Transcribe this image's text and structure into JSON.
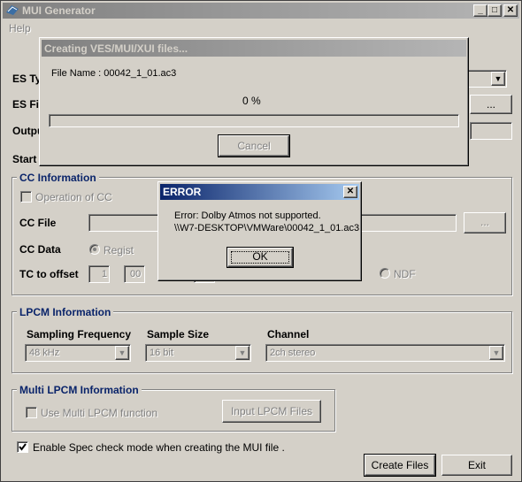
{
  "main_window": {
    "title": "MUI Generator",
    "menu": {
      "help": "Help"
    },
    "es_type_label": "ES Ty",
    "es_file_label": "ES File",
    "output_label": "Outpu",
    "start_label": "Start",
    "browse_label": "...",
    "cc": {
      "group_title": "CC Information",
      "operation_label": "Operation of CC",
      "file_label": "CC File",
      "browse_label": "...",
      "data_label": "CC Data",
      "regist_label": "Regist",
      "tc_offset_label": "TC to offset",
      "tc_values": [
        "1",
        "00"
      ],
      "ndf_label": "NDF"
    },
    "lpcm": {
      "group_title": "LPCM Information",
      "sampling_label": "Sampling Frequency",
      "sampling_value": "48 kHz",
      "sample_size_label": "Sample Size",
      "sample_size_value": "16 bit",
      "channel_label": "Channel",
      "channel_value": "2ch stereo"
    },
    "multi": {
      "group_title": "Multi LPCM Information",
      "use_label": "Use Multi LPCM function",
      "input_button": "Input LPCM Files"
    },
    "spec_check_label": "Enable Spec check mode when creating the MUI file .",
    "create_button": "Create Files",
    "exit_button": "Exit"
  },
  "progress_dialog": {
    "title": "Creating VES/MUI/XUI files...",
    "file_name_text": "File Name : 00042_1_01.ac3",
    "percent_text": "0 %",
    "progress_value": 0,
    "cancel_button": "Cancel"
  },
  "error_dialog": {
    "title": "ERROR",
    "message_line1": "Error: Dolby Atmos not supported.",
    "message_line2": "\\\\W7-DESKTOP\\VMWare\\00042_1_01.ac3",
    "ok_button": "OK"
  },
  "colors": {
    "face": "#d4d0c8",
    "active_title": "#0a246a",
    "inactive_title": "#808080",
    "group_title": "#0a246a"
  }
}
